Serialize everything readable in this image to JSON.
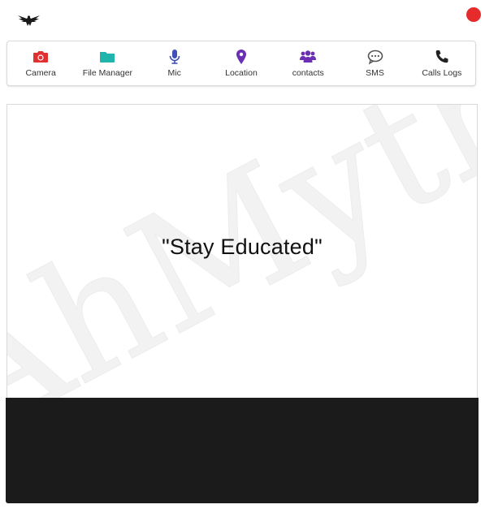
{
  "colors": {
    "accent_red": "#e52b2b",
    "camera": "#e03030",
    "file_manager": "#1fb5ad",
    "mic": "#3f51b5",
    "location": "#6a2fb3",
    "contacts": "#6a2fb3",
    "sms": "#555555",
    "calls": "#222222",
    "log_panel": "#1b1b1b"
  },
  "app": {
    "logo_icon": "eagle-icon",
    "close_icon": "close-icon"
  },
  "nav": {
    "items": [
      {
        "label": "Camera",
        "icon": "camera-icon"
      },
      {
        "label": "File Manager",
        "icon": "folder-icon"
      },
      {
        "label": "Mic",
        "icon": "microphone-icon"
      },
      {
        "label": "Location",
        "icon": "map-marker-icon"
      },
      {
        "label": "contacts",
        "icon": "users-icon"
      },
      {
        "label": "SMS",
        "icon": "comment-dots-icon"
      },
      {
        "label": "Calls Logs",
        "icon": "phone-icon"
      }
    ]
  },
  "main": {
    "watermark": "AhMyth",
    "quote": "\"Stay Educated\""
  }
}
